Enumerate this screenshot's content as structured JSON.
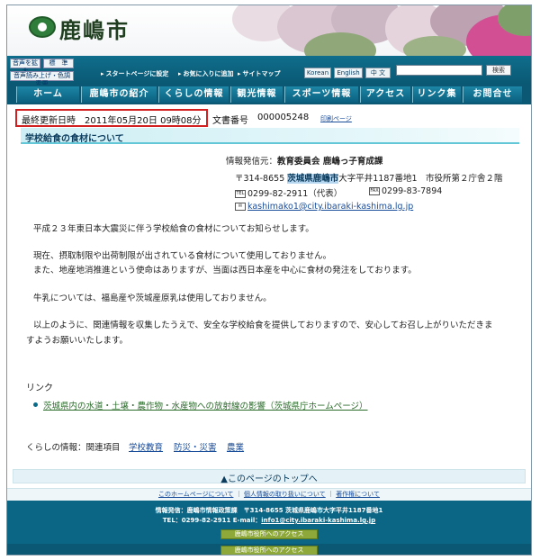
{
  "header": {
    "site_name": "鹿嶋市"
  },
  "utility": {
    "text_enlarge": "音声を拡大",
    "text_standard": "標　準",
    "speech_color": "音声読み上げ・色調変更",
    "start_page": "スタートページに設定",
    "favorites": "お気に入りに追加",
    "sitemap": "サイトマップ",
    "lang_korean": "Korean",
    "lang_english": "English",
    "lang_chinese": "中 文",
    "search_placeholder": "",
    "search_button": "検索"
  },
  "nav": {
    "items": [
      "ホーム",
      "鹿嶋市の紹介",
      "くらしの情報",
      "観光情報",
      "スポーツ情報",
      "アクセス",
      "リンク集",
      "お問合せ"
    ]
  },
  "meta": {
    "update_label": "最終更新日時",
    "update_value": "2011年05月20日 09時08分",
    "docnum_label": "文書番号",
    "docnum_value": "000005248",
    "print_label": "印刷ページ"
  },
  "page": {
    "title": "学校給食の食材について"
  },
  "publisher": {
    "from_label": "情報発信元：",
    "from_value": "教育委員会 鹿嶋っ子育成課",
    "postal": "〒314-8655",
    "address_hl": "茨城県鹿嶋市",
    "address_rest": "大字平井1187番地1　市役所第２庁舎２階",
    "tel_icon": "TEL",
    "tel": "0299-82-2911（代表）",
    "fax_icon": "FAX",
    "fax": "0299-83-7894",
    "mail_icon": "✉",
    "email": "kashimako1@city.ibaraki-kashima.lg.jp"
  },
  "body": {
    "p1": "平成２３年東日本大震災に伴う学校給食の食材についてお知らせします。",
    "p2a": "現在、摂取制限や出荷制限が出されている食材について使用しておりません。",
    "p2b": "また、地産地消推進という使命はありますが、当面は西日本産を中心に食材の発注をしております。",
    "p3": "牛乳については、福島産や茨城産原乳は使用しておりません。",
    "p4a": "以上のように、関連情報を収集したうえで、安全な学校給食を提供しておりますので、安心してお召し上がりいただきま",
    "p4b": "すようお願いいたします。"
  },
  "links": {
    "title": "リンク",
    "item1": "茨城県内の水道・土壌・農作物・水産物への放射線の影響（茨城県庁ホームページ）"
  },
  "category": {
    "label": "くらしの情報：関連項目",
    "items": [
      "学校教育",
      "防災・災害",
      "農業"
    ]
  },
  "totop": "▲このページのトップへ",
  "footer": {
    "link_about": "このホームページについて",
    "sep": "｜",
    "link_privacy": "個人情報の取り扱いについて",
    "link_copyright": "著作権について",
    "line1": "情報発信：鹿嶋市情報政策課　〒314-8655 茨城県鹿嶋市大字平井1187番地1",
    "line2_prefix": "TEL：0299-82-2911 E-mail：",
    "line2_email": "info1@city.ibaraki-kashima.lg.jp",
    "access1": "鹿嶋市役所へのアクセス",
    "access2": "鹿嶋市役所へのアクセス"
  },
  "colors": {
    "nav_bg": "#0b5f7e",
    "highlight_box": "#d21f1f",
    "heading_bg": "#cdeef4",
    "footer_bg": "#0b6584"
  }
}
